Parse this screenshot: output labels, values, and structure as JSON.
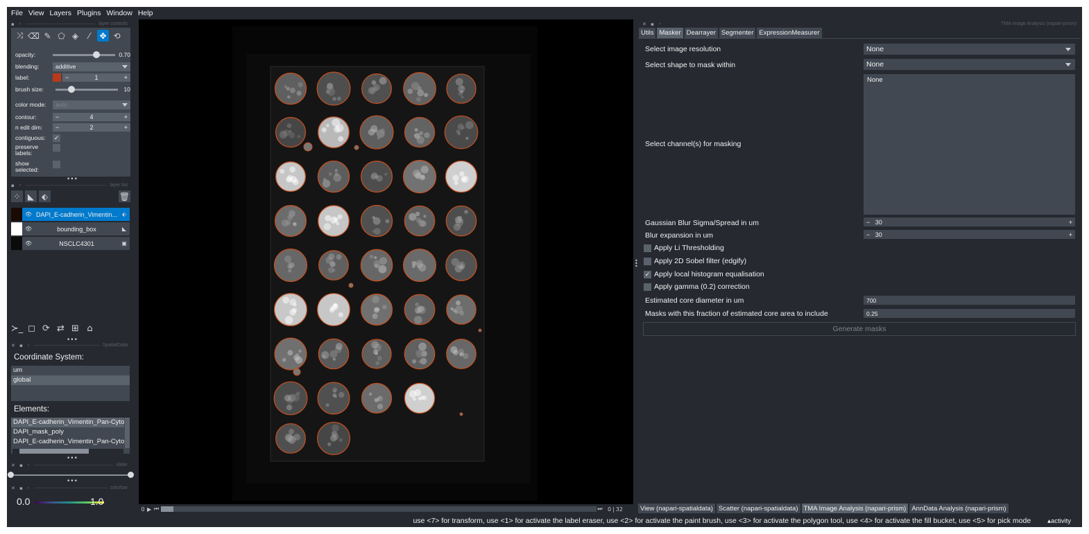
{
  "menubar": {
    "items": [
      "File",
      "View",
      "Layers",
      "Plugins",
      "Window",
      "Help"
    ]
  },
  "layer_controls": {
    "header": "layer controls",
    "toolbar_icons": [
      "shuffle-icon",
      "eraser-icon",
      "paint-brush-icon",
      "polygon-icon",
      "fill-bucket-icon",
      "color-picker-icon",
      "pan-zoom-icon",
      "transform-icon"
    ],
    "opacity": {
      "label": "opacity:",
      "value": "0.70",
      "fraction": 0.7
    },
    "blending": {
      "label": "blending:",
      "value": "additive"
    },
    "label": {
      "label": "label:",
      "value": "1",
      "color": "#b83a1a"
    },
    "brush_size": {
      "label": "brush size:",
      "value": "10",
      "fraction": 0.25
    },
    "color_mode": {
      "label": "color mode:",
      "value": "auto"
    },
    "contour": {
      "label": "contour:",
      "value": "4"
    },
    "n_edit_dim": {
      "label": "n edit dim:",
      "value": "2"
    },
    "contiguous": {
      "label": "contiguous:",
      "checked": true
    },
    "preserve_labels": {
      "label": "preserve labels:",
      "checked": false
    },
    "show_selected": {
      "label": "show selected:",
      "checked": false
    }
  },
  "layer_list": {
    "header": "layer list",
    "layers": [
      {
        "name": "DAPI_E-cadherin_Vimentin...",
        "type_icon": "labels-icon",
        "selected": true
      },
      {
        "name": "bounding_box",
        "type_icon": "shapes-icon",
        "selected": false
      },
      {
        "name": "NSCLC4301",
        "type_icon": "image-icon",
        "selected": false
      }
    ]
  },
  "spatialdata": {
    "header": "SpatialData",
    "coord_label": "Coordinate System:",
    "coord_systems": [
      "um",
      "global"
    ],
    "elements_label": "Elements:",
    "elements": [
      "DAPI_E-cadherin_Vimentin_Pan-Cytoke",
      "DAPI_mask_poly",
      "DAPI_E-cadherin_Vimentin_Pan-Cytoke"
    ]
  },
  "slider_dock": {
    "header": "slider"
  },
  "colorbar": {
    "header": "colorbar",
    "min": "0.0",
    "max": "1.0"
  },
  "dims": {
    "start": "0",
    "value": "0",
    "max": "32"
  },
  "tma": {
    "title": "TMA Image Analysis (napari-prism)",
    "tabs": [
      "Utils",
      "Masker",
      "Dearrayer",
      "Segmenter",
      "ExpressionMeasurer"
    ],
    "selected_tab": "Masker",
    "res_label": "Select image resolution",
    "res_value": "None",
    "shape_label": "Select shape to mask within",
    "shape_value": "None",
    "channel_label": "Select channel(s) for masking",
    "channel_list": [
      "None"
    ],
    "sigma_label": "Gaussian Blur Sigma/Spread in um",
    "sigma_value": "30",
    "blur_label": "Blur expansion in um",
    "blur_value": "30",
    "checks": [
      {
        "label": "Apply Li Thresholding",
        "checked": false
      },
      {
        "label": "Apply 2D Sobel filter (edgify)",
        "checked": false
      },
      {
        "label": "Apply local histogram equalisation",
        "checked": true
      },
      {
        "label": "Apply gamma (0.2) correction",
        "checked": false
      }
    ],
    "diam_label": "Estimated core diameter in um",
    "diam_value": "700",
    "frac_label": "Masks with this fraction of estimated core area to include",
    "frac_value": "0.25",
    "generate": "Generate masks"
  },
  "bottom_tabs": [
    "View (napari-spatialdata)",
    "Scatter (napari-spatialdata)",
    "TMA Image Analysis (napari-prism)",
    "AnnData Analysis (napari-prism)"
  ],
  "selected_bottom_tab": "TMA Image Analysis (napari-prism)",
  "status": {
    "message": "use <7> for transform, use <1> for activate the label eraser, use <2> for activate the paint brush, use <3> for activate the polygon tool, use <4> for activate the fill bucket, use <5> for pick mode",
    "activity": "activity"
  },
  "console_icons": [
    "console-icon",
    "ndisplay-icon",
    "roll-dims-icon",
    "transpose-icon",
    "grid-icon",
    "home-icon"
  ],
  "colors": {
    "accent": "#007acc",
    "core_outline": "#c8501e",
    "bg": "#262930"
  }
}
